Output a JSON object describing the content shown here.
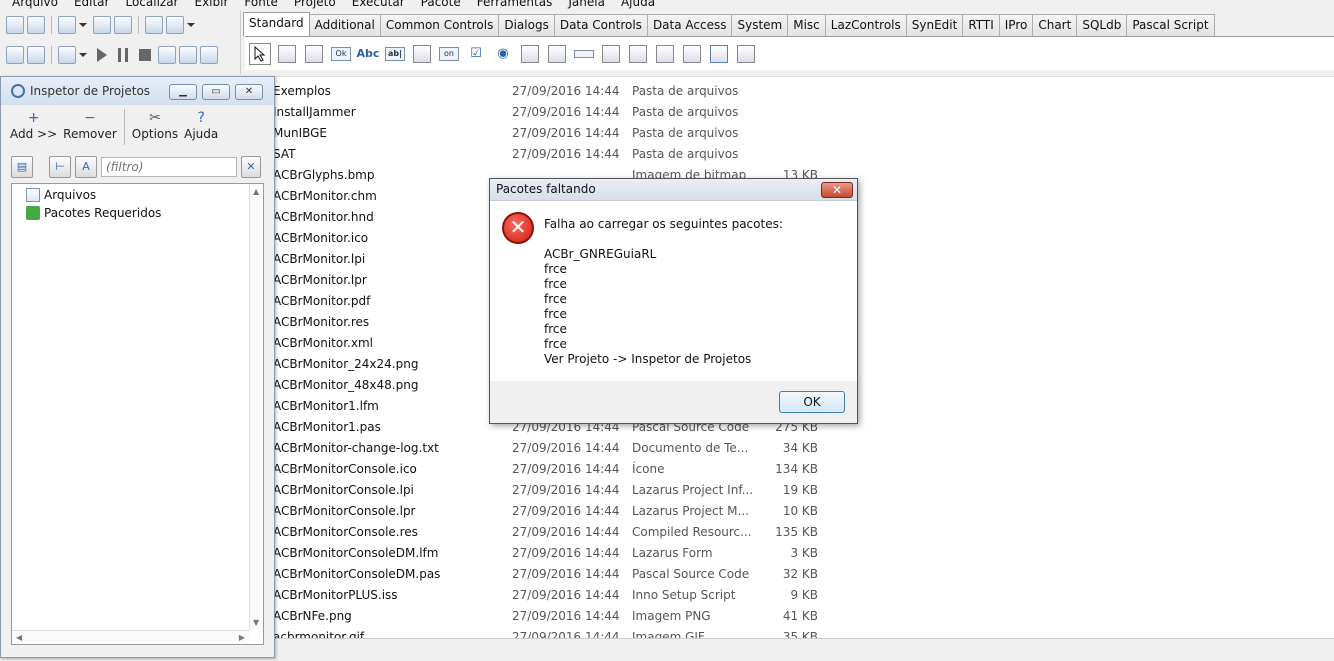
{
  "menubar": [
    "Arquivo",
    "Editar",
    "Localizar",
    "Exibir",
    "Fonte",
    "Projeto",
    "Executar",
    "Pacote",
    "Ferramentas",
    "Janela",
    "Ajuda"
  ],
  "palette": {
    "tabs": [
      "Standard",
      "Additional",
      "Common Controls",
      "Dialogs",
      "Data Controls",
      "Data Access",
      "System",
      "Misc",
      "LazControls",
      "SynEdit",
      "RTTI",
      "IPro",
      "Chart",
      "SQLdb",
      "Pascal Script"
    ],
    "active_tab": "Standard",
    "ok_label": "Ok",
    "abc_label": "Abc",
    "on_label": "on"
  },
  "inspector": {
    "title": "Inspetor de Projetos",
    "tools": [
      {
        "icon": "+",
        "label": "Add >>"
      },
      {
        "icon": "−",
        "label": "Remover"
      },
      {
        "icon": "✂",
        "label": "Options"
      },
      {
        "icon": "?",
        "label": "Ajuda"
      }
    ],
    "filter_placeholder": "(filtro)",
    "tree": [
      "Arquivos",
      "Pacotes Requeridos"
    ]
  },
  "files": [
    {
      "name": "Exemplos",
      "date": "27/09/2016 14:44",
      "type": "Pasta de arquivos",
      "size": ""
    },
    {
      "name": "InstallJammer",
      "date": "27/09/2016 14:44",
      "type": "Pasta de arquivos",
      "size": ""
    },
    {
      "name": "MunIBGE",
      "date": "27/09/2016 14:44",
      "type": "Pasta de arquivos",
      "size": ""
    },
    {
      "name": "SAT",
      "date": "27/09/2016 14:44",
      "type": "Pasta de arquivos",
      "size": ""
    },
    {
      "name": "ACBrGlyphs.bmp",
      "date": "",
      "type": "Imagem de bitmap",
      "size": "13 KB"
    },
    {
      "name": "ACBrMonitor.chm",
      "date": "",
      "type": "",
      "size": ""
    },
    {
      "name": "ACBrMonitor.hnd",
      "date": "",
      "type": "",
      "size": ""
    },
    {
      "name": "ACBrMonitor.ico",
      "date": "",
      "type": "",
      "size": ""
    },
    {
      "name": "ACBrMonitor.lpi",
      "date": "",
      "type": "",
      "size": ""
    },
    {
      "name": "ACBrMonitor.lpr",
      "date": "",
      "type": "",
      "size": ""
    },
    {
      "name": "ACBrMonitor.pdf",
      "date": "",
      "type": "",
      "size": ""
    },
    {
      "name": "ACBrMonitor.res",
      "date": "",
      "type": "",
      "size": ""
    },
    {
      "name": "ACBrMonitor.xml",
      "date": "",
      "type": "",
      "size": ""
    },
    {
      "name": "ACBrMonitor_24x24.png",
      "date": "",
      "type": "",
      "size": ""
    },
    {
      "name": "ACBrMonitor_48x48.png",
      "date": "",
      "type": "",
      "size": ""
    },
    {
      "name": "ACBrMonitor1.lfm",
      "date": "",
      "type": "",
      "size": ""
    },
    {
      "name": "ACBrMonitor1.pas",
      "date": "27/09/2016 14:44",
      "type": "Pascal Source Code",
      "size": "275 KB"
    },
    {
      "name": "ACBrMonitor-change-log.txt",
      "date": "27/09/2016 14:44",
      "type": "Documento de Te...",
      "size": "34 KB"
    },
    {
      "name": "ACBrMonitorConsole.ico",
      "date": "27/09/2016 14:44",
      "type": "Ícone",
      "size": "134 KB"
    },
    {
      "name": "ACBrMonitorConsole.lpi",
      "date": "27/09/2016 14:44",
      "type": "Lazarus Project Inf...",
      "size": "19 KB"
    },
    {
      "name": "ACBrMonitorConsole.lpr",
      "date": "27/09/2016 14:44",
      "type": "Lazarus Project M...",
      "size": "10 KB"
    },
    {
      "name": "ACBrMonitorConsole.res",
      "date": "27/09/2016 14:44",
      "type": "Compiled Resourc...",
      "size": "135 KB"
    },
    {
      "name": "ACBrMonitorConsoleDM.lfm",
      "date": "27/09/2016 14:44",
      "type": "Lazarus Form",
      "size": "3 KB"
    },
    {
      "name": "ACBrMonitorConsoleDM.pas",
      "date": "27/09/2016 14:44",
      "type": "Pascal Source Code",
      "size": "32 KB"
    },
    {
      "name": "ACBrMonitorPLUS.iss",
      "date": "27/09/2016 14:44",
      "type": "Inno Setup Script",
      "size": "9 KB"
    },
    {
      "name": "ACBrNFe.png",
      "date": "27/09/2016 14:44",
      "type": "Imagem PNG",
      "size": "41 KB"
    },
    {
      "name": "acbrmonitor.gif",
      "date": "27/09/2016 14:44",
      "type": "Imagem GIF",
      "size": "35 KB"
    }
  ],
  "dialog": {
    "title": "Pacotes faltando",
    "close": "✕",
    "heading": "Falha ao carregar os seguintes pacotes:",
    "lines": [
      "ACBr_GNREGuiaRL",
      "frce",
      "frce",
      "frce",
      "frce",
      "frce",
      "frce",
      "Ver Projeto -> Inspetor de Projetos"
    ],
    "ok": "OK"
  }
}
